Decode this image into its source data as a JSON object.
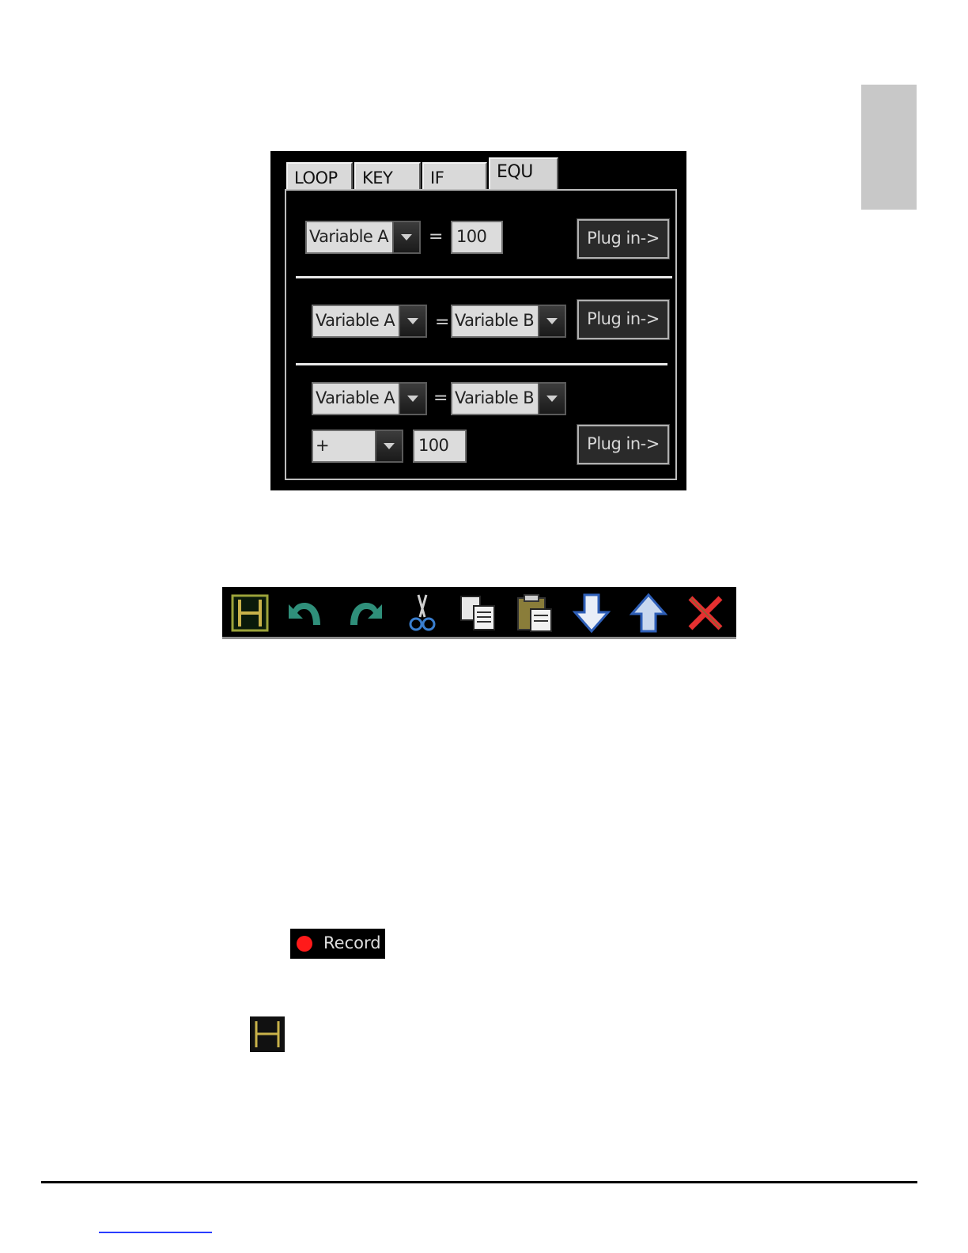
{
  "tabs": [
    {
      "label": "LOOP"
    },
    {
      "label": "KEY"
    },
    {
      "label": "IF"
    },
    {
      "label": "EQU",
      "active": true
    }
  ],
  "rows": {
    "row1": {
      "left_var": "Variable A",
      "equals": "=",
      "value": "100",
      "plug_label": "Plug in->"
    },
    "row2": {
      "left_var": "Variable A",
      "equals": "=",
      "right_var": "Variable B",
      "plug_label": "Plug in->"
    },
    "row3": {
      "left_var": "Variable A",
      "equals": "=",
      "right_var": "Variable B",
      "operator": "+",
      "value": "100",
      "plug_label": "Plug in->"
    }
  },
  "toolbar": {
    "icons": [
      "stop-icon",
      "undo-icon",
      "redo-icon",
      "cut-icon",
      "copy-icon",
      "paste-icon",
      "move-down-icon",
      "move-up-icon",
      "delete-icon"
    ]
  },
  "record": {
    "label": "Record",
    "dot_color": "#ff1a1a"
  },
  "colors": {
    "dialog_bg": "#000000",
    "control_bg": "#dcdcdc",
    "accent_link": "#2a3dff"
  }
}
